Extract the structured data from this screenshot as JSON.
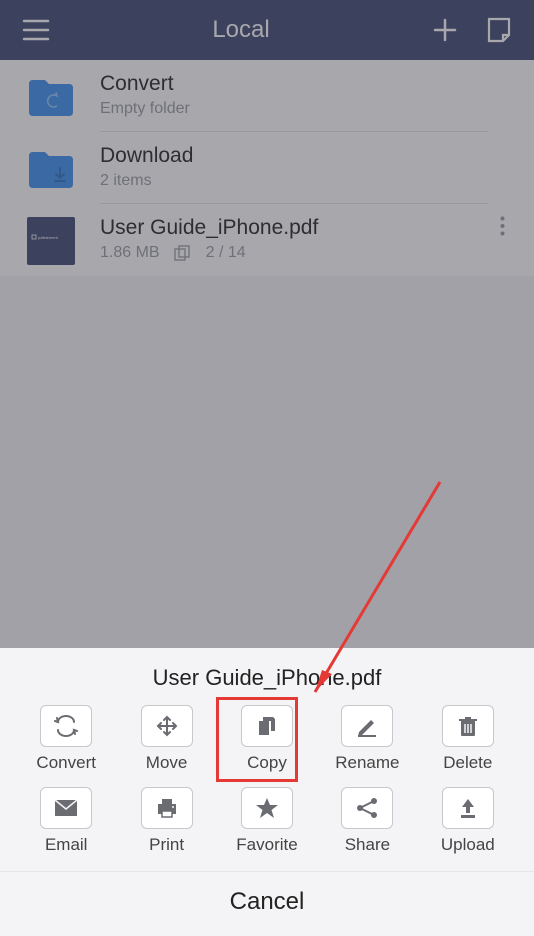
{
  "header": {
    "title": "Local"
  },
  "files": [
    {
      "name": "Convert",
      "meta1": "Empty folder",
      "meta2": "",
      "type": "folder-sync"
    },
    {
      "name": "Download",
      "meta1": "2 items",
      "meta2": "",
      "type": "folder-down"
    },
    {
      "name": "User Guide_iPhone.pdf",
      "meta1": "1.86 MB",
      "meta2": "2 / 14",
      "type": "pdf"
    }
  ],
  "sheet": {
    "title": "User Guide_iPhone.pdf",
    "actions": [
      {
        "label": "Convert"
      },
      {
        "label": "Move"
      },
      {
        "label": "Copy"
      },
      {
        "label": "Rename"
      },
      {
        "label": "Delete"
      },
      {
        "label": "Email"
      },
      {
        "label": "Print"
      },
      {
        "label": "Favorite"
      },
      {
        "label": "Share"
      },
      {
        "label": "Upload"
      }
    ],
    "cancel": "Cancel"
  },
  "annotation": {
    "highlight_index": 2,
    "arrow_color": "#e53935"
  },
  "colors": {
    "brand": "#3c4571",
    "folder": "#3a8ef0",
    "icon_gray": "#6b6b72"
  }
}
